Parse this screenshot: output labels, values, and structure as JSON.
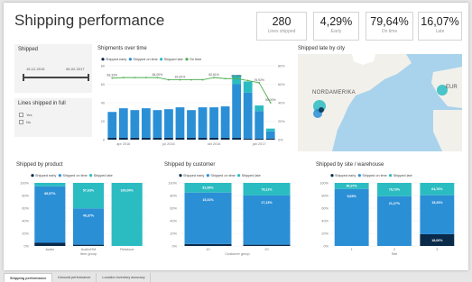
{
  "title": "Shipping performance",
  "kpis": [
    {
      "value": "280",
      "label": "Lines shipped"
    },
    {
      "value": "4,29%",
      "label": "Early"
    },
    {
      "value": "79,64%",
      "label": "On time"
    },
    {
      "value": "16,07%",
      "label": "Late"
    }
  ],
  "filters": {
    "shipped": {
      "title": "Shipped",
      "date_from": "15-12-2015",
      "date_to": "06-02-2017"
    },
    "in_full": {
      "title": "Lines shipped in full",
      "options": [
        "Yes",
        "No"
      ]
    }
  },
  "colors": {
    "early": "#0a2a4a",
    "on_time": "#2b8fd6",
    "late": "#2bbcc2",
    "on_time_line": "#4caf50",
    "slicer_bar": "#444444"
  },
  "legend": {
    "early": "Shipped early",
    "on_time": "Shipped on time",
    "late": "Shipped late",
    "on_time_pct": "On time"
  },
  "shipments_over_time": {
    "title": "Shipments over time",
    "y_ticks": [
      "80",
      "60",
      "40",
      "20",
      "0"
    ],
    "y2_ticks": [
      "80%",
      "60%",
      "40%",
      "20%",
      "0%"
    ],
    "x_labels": [
      "apr 2016",
      "jul 2016",
      "okt 2016",
      "jan 2017"
    ],
    "data_labels": [
      "83,33%",
      "84,00%",
      "81,00%",
      "82,61%",
      "80,00%",
      "76,92%",
      "50,00%"
    ],
    "chart_data": {
      "type": "bar",
      "ylim": [
        0,
        80
      ],
      "y2lim": [
        0,
        100
      ],
      "early": [
        2,
        2,
        2,
        2,
        2,
        2,
        2,
        2,
        2,
        2,
        2,
        2,
        1,
        1,
        1
      ],
      "on_time": [
        28,
        32,
        30,
        32,
        30,
        31,
        33,
        30,
        33,
        33,
        34,
        58,
        50,
        30,
        8
      ],
      "late": [
        0,
        0,
        0,
        0,
        0,
        0,
        0,
        0,
        0,
        0,
        0,
        10,
        12,
        6,
        3
      ],
      "on_time_pct": [
        83.33,
        84,
        84,
        84,
        84,
        81,
        81,
        81,
        81,
        84,
        82.61,
        82.61,
        80,
        76.92,
        50
      ]
    }
  },
  "map": {
    "title": "Shipped late by city",
    "label_na": "NORDAMERIKA",
    "label_eu": "EUR"
  },
  "product": {
    "title": "Shipped by product",
    "y_ticks": [
      "100%",
      "80%",
      "60%",
      "40%",
      "20%",
      "0%"
    ],
    "categories": [
      "Audio",
      "Audio/HM",
      "Fietstoos"
    ],
    "axis_label": "Item group",
    "chart_data": {
      "type": "bar",
      "stacked": true,
      "early": [
        5,
        2,
        0
      ],
      "on_time": [
        89.57,
        57.63,
        0
      ],
      "late": [
        5.43,
        40.37,
        100
      ]
    },
    "labels": [
      [
        "89,57%"
      ],
      [
        "57,63%",
        "40,37%"
      ],
      [
        "100,00%"
      ]
    ]
  },
  "customer": {
    "title": "Shipped by customer",
    "y_ticks": [
      "100%",
      "80%",
      "60%",
      "40%",
      "20%",
      "0%"
    ],
    "categories": [
      "10",
      "20"
    ],
    "axis_label": "Customer group",
    "chart_data": {
      "type": "bar",
      "stacked": true,
      "early": [
        3.1,
        2
      ],
      "on_time": [
        81.59,
        78.11
      ],
      "late": [
        15.31,
        19.89
      ]
    },
    "labels": [
      [
        "81,59%",
        "15,31%"
      ],
      [
        "78,11%",
        "17,13%"
      ]
    ]
  },
  "site": {
    "title": "Shipped by site / warehouse",
    "y_ticks": [
      "100%",
      "80%",
      "60%",
      "40%",
      "20%",
      "0%"
    ],
    "categories": [
      "1",
      "2",
      "3"
    ],
    "axis_label": "Site",
    "chart_data": {
      "type": "bar",
      "stacked": true,
      "early": [
        0,
        0,
        18.66
      ],
      "on_time": [
        90.37,
        78.73,
        61.76
      ],
      "late": [
        9.63,
        21.27,
        19.58
      ]
    },
    "labels": [
      [
        "90,37%",
        "9,63%"
      ],
      [
        "78,73%",
        "21,27%"
      ],
      [
        "64,76%",
        "15,33%",
        "18,66%"
      ]
    ]
  },
  "tabs": [
    "Shipping performance",
    "Inbound performance",
    "Location inventory accuracy"
  ]
}
